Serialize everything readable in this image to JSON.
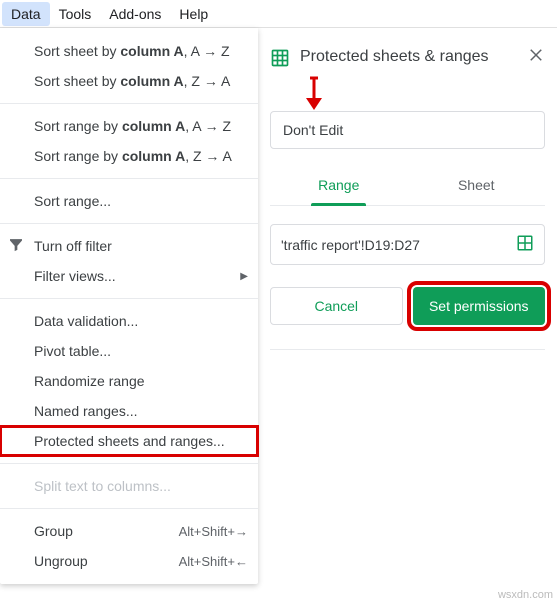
{
  "menubar": {
    "items": [
      "Data",
      "Tools",
      "Add-ons",
      "Help"
    ],
    "active_index": 0
  },
  "dropdown": {
    "sort_sheet_az_prefix": "Sort sheet by ",
    "sort_sheet_az_bold": "column A",
    "sort_sheet_az_suffix": ", A → Z",
    "sort_sheet_za_prefix": "Sort sheet by ",
    "sort_sheet_za_bold": "column A",
    "sort_sheet_za_suffix": ", Z → A",
    "sort_range_az_prefix": "Sort range by ",
    "sort_range_az_bold": "column A",
    "sort_range_az_suffix": ", A → Z",
    "sort_range_za_prefix": "Sort range by ",
    "sort_range_za_bold": "column A",
    "sort_range_za_suffix": ", Z → A",
    "sort_range": "Sort range...",
    "turn_off_filter": "Turn off filter",
    "filter_views": "Filter views...",
    "data_validation": "Data validation...",
    "pivot_table": "Pivot table...",
    "randomize_range": "Randomize range",
    "named_ranges": "Named ranges...",
    "protected_sheets": "Protected sheets and ranges...",
    "split_text": "Split text to columns...",
    "group": "Group",
    "group_shortcut": "Alt+Shift+→",
    "ungroup": "Ungroup",
    "ungroup_shortcut": "Alt+Shift+←"
  },
  "panel": {
    "title": "Protected sheets & ranges",
    "description_value": "Don't Edit",
    "tab_range": "Range",
    "tab_sheet": "Sheet",
    "range_value": "'traffic report'!D19:D27",
    "cancel": "Cancel",
    "set_permissions": "Set permissions"
  },
  "watermark": "wsxdn.com"
}
